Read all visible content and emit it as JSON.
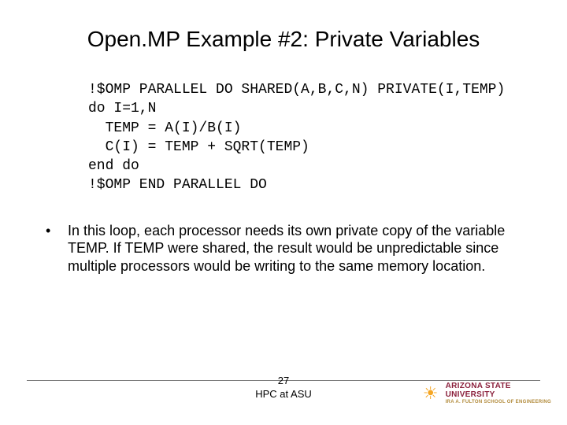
{
  "title": "Open.MP Example #2: Private Variables",
  "code": {
    "l1": "!$OMP PARALLEL DO SHARED(A,B,C,N) PRIVATE(I,TEMP)",
    "l2": "do I=1,N",
    "l3": "  TEMP = A(I)/B(I)",
    "l4": "  C(I) = TEMP + SQRT(TEMP)",
    "l5": "end do",
    "l6": "!$OMP END PARALLEL DO"
  },
  "bullet": {
    "dot": "•",
    "text": "In this loop, each processor needs its own private copy of the variable TEMP. If TEMP were shared, the result would be unpredictable since multiple processors would be writing to the same memory location."
  },
  "footer": {
    "page": "27",
    "label": "HPC at ASU"
  },
  "logo": {
    "line1": "ARIZONA STATE",
    "line2": "UNIVERSITY",
    "line3": "IRA A. FULTON SCHOOL OF ENGINEERING"
  }
}
